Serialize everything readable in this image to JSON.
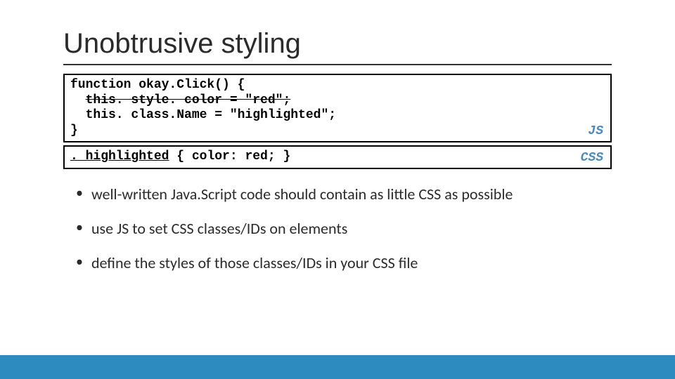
{
  "title": "Unobtrusive styling",
  "code_js": {
    "line1": "function okay.Click() {",
    "line2_strike": "this. style. color = \"red\";",
    "line3": "this. class.Name = \"highlighted\";",
    "line4": "}",
    "lang": "JS"
  },
  "code_css": {
    "line1_underlined": ". highlighted",
    "line1_rest": " { color: red; }",
    "lang": "CSS"
  },
  "bullets": [
    "well-written Java.Script code should contain as little CSS as possible",
    "use JS to set CSS classes/IDs on elements",
    "define the styles of those classes/IDs in your CSS file"
  ],
  "colors": {
    "footer": "#2e8bc0",
    "lang_label": "#4a8abf"
  }
}
